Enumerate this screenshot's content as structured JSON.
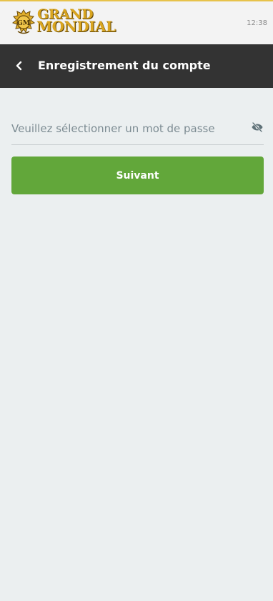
{
  "brand": {
    "line1": "GRAND",
    "line2": "MONDIAL",
    "emblem_text": "GM",
    "colors": {
      "gold": "#d9a520",
      "dark_gold": "#5a4006"
    }
  },
  "status": {
    "time": "12:38"
  },
  "header": {
    "title": "Enregistrement du compte",
    "back_icon": "chevron-left-icon"
  },
  "form": {
    "password": {
      "value": "",
      "placeholder": "Veuillez sélectionner un mot de passe",
      "toggle_icon": "eye-off-icon"
    },
    "submit_label": "Suivant"
  },
  "colors": {
    "topbar_accent": "#e7c24a",
    "header_bg": "#333333",
    "page_bg": "#ebeff0",
    "button_bg": "#62a73a",
    "placeholder": "#7d8c93"
  }
}
